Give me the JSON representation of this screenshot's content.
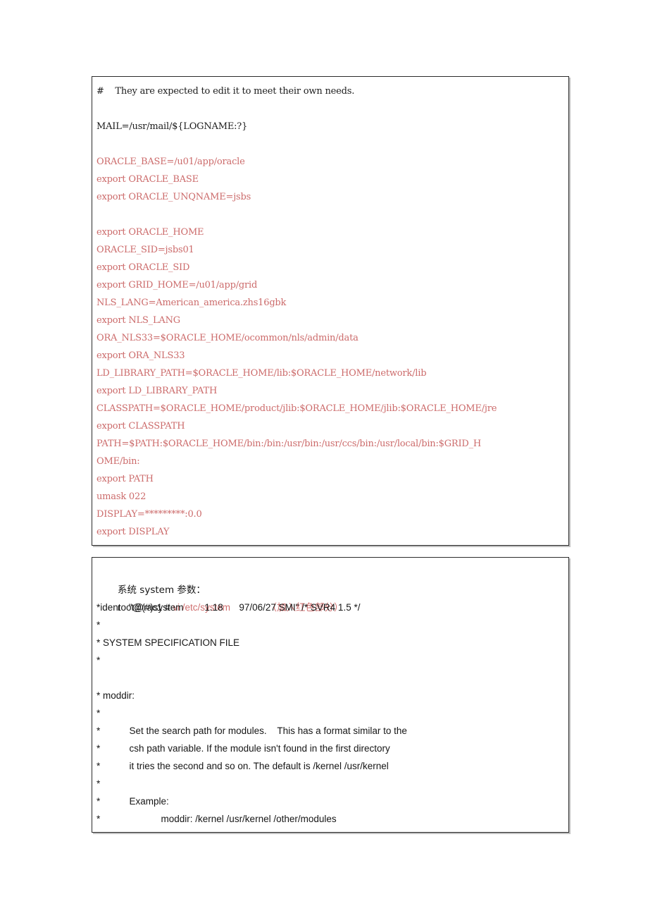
{
  "document": {
    "page_background": "#ffffff",
    "text_color": "#1c1c1c",
    "accent_red": "#cc6b6b"
  },
  "profile_box": {
    "name": "oracle-profile-listing",
    "lines": [
      {
        "text": "#    They are expected to edit it to meet their own needs.",
        "color": "black"
      },
      {
        "text": "",
        "color": "black"
      },
      {
        "text": "MAIL=/usr/mail/${LOGNAME:?}",
        "color": "black"
      },
      {
        "text": "",
        "color": "black"
      },
      {
        "text": "ORACLE_BASE=/u01/app/oracle",
        "color": "red"
      },
      {
        "text": "export ORACLE_BASE",
        "color": "red"
      },
      {
        "text": "export ORACLE_UNQNAME=jsbs",
        "color": "red"
      },
      {
        "text": "",
        "color": "red"
      },
      {
        "text": "export ORACLE_HOME",
        "color": "red"
      },
      {
        "text": "ORACLE_SID=jsbs01",
        "color": "red"
      },
      {
        "text": "export ORACLE_SID",
        "color": "red"
      },
      {
        "text": "export GRID_HOME=/u01/app/grid",
        "color": "red"
      },
      {
        "text": "NLS_LANG=American_america.zhs16gbk",
        "color": "red"
      },
      {
        "text": "export NLS_LANG",
        "color": "red"
      },
      {
        "text": "ORA_NLS33=$ORACLE_HOME/ocommon/nls/admin/data",
        "color": "red"
      },
      {
        "text": "export ORA_NLS33",
        "color": "red"
      },
      {
        "text": "LD_LIBRARY_PATH=$ORACLE_HOME/lib:$ORACLE_HOME/network/lib",
        "color": "red"
      },
      {
        "text": "export LD_LIBRARY_PATH",
        "color": "red"
      },
      {
        "text": "CLASSPATH=$ORACLE_HOME/product/jlib:$ORACLE_HOME/jlib:$ORACLE_HOME/jre",
        "color": "red"
      },
      {
        "text": "export CLASSPATH",
        "color": "red"
      },
      {
        "text": "PATH=$PATH:$ORACLE_HOME/bin:/bin:/usr/bin:/usr/ccs/bin:/usr/local/bin:$GRID_H",
        "color": "red"
      },
      {
        "text": "OME/bin:",
        "color": "red"
      },
      {
        "text": "export PATH",
        "color": "red"
      },
      {
        "text": "umask 022",
        "color": "red"
      },
      {
        "text": "DISPLAY=*********:0.0",
        "color": "red"
      },
      {
        "text": "export DISPLAY",
        "color": "red"
      }
    ]
  },
  "system_box": {
    "name": "etc-system-listing",
    "heading": "系统 system 参数：",
    "command_prefix": "root@rac1 # ",
    "command": "vi /etc/system",
    "command_gap": "              ",
    "annotation": "（加入红色部分）",
    "lines": [
      "*ident   \"@(#)system        1.18      97/06/27 SMI\" /* SVR4 1.5 */",
      "*",
      "* SYSTEM SPECIFICATION FILE",
      "*",
      "",
      "* moddir:",
      "*",
      "*           Set the search path for modules.    This has a format similar to the",
      "*           csh path variable. If the module isn't found in the first directory",
      "*           it tries the second and so on. The default is /kernel /usr/kernel",
      "*",
      "*           Example:",
      "*                       moddir: /kernel /usr/kernel /other/modules"
    ]
  }
}
